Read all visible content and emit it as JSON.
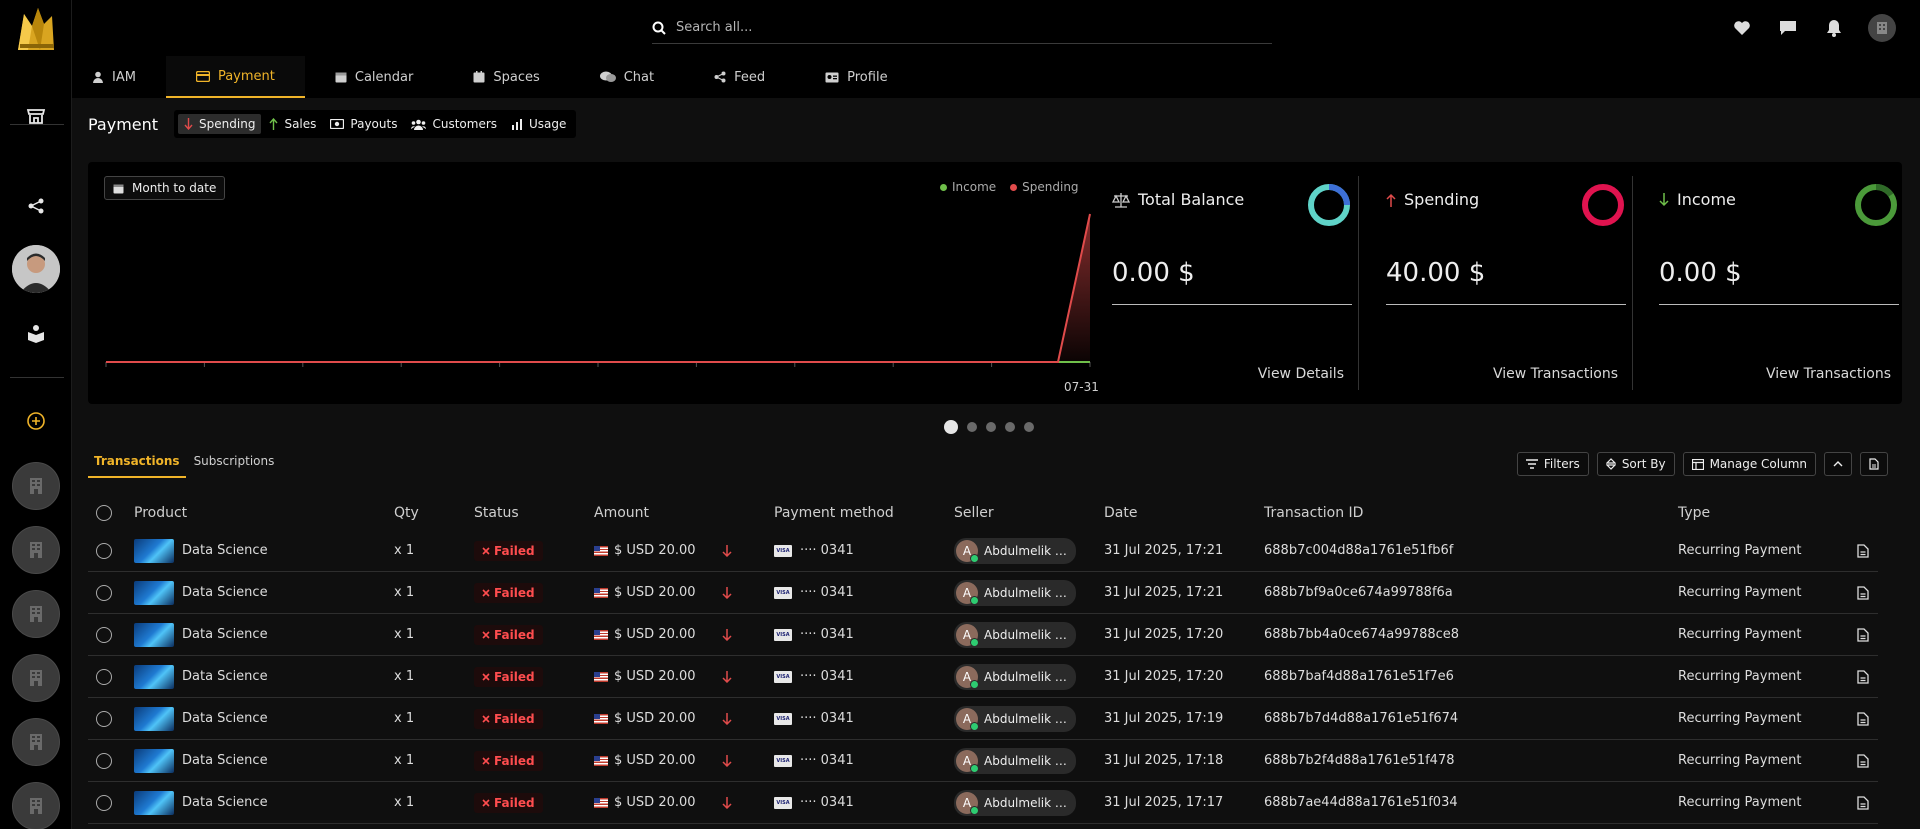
{
  "search": {
    "placeholder": "Search all..."
  },
  "modules": [
    {
      "label": "IAM",
      "icon": "user-icon"
    },
    {
      "label": "Payment",
      "icon": "card-icon",
      "active": true
    },
    {
      "label": "Calendar",
      "icon": "calendar-icon"
    },
    {
      "label": "Spaces",
      "icon": "spaces-icon"
    },
    {
      "label": "Chat",
      "icon": "chat-icon"
    },
    {
      "label": "Feed",
      "icon": "share-icon"
    },
    {
      "label": "Profile",
      "icon": "id-card-icon"
    }
  ],
  "page": {
    "title": "Payment",
    "subtabs": [
      "Spending",
      "Sales",
      "Payouts",
      "Customers",
      "Usage"
    ]
  },
  "overview": {
    "range_label": "Month to date",
    "legend": [
      {
        "name": "Income",
        "color": "#6fbf4a"
      },
      {
        "name": "Spending",
        "color": "#e04b4b"
      }
    ],
    "last_date": "07-31",
    "cards": [
      {
        "title": "Total Balance",
        "value": "0.00 $",
        "link": "View Details",
        "icon": "balance-scale-icon"
      },
      {
        "title": "Spending",
        "value": "40.00 $",
        "link": "View Transactions",
        "icon": "arrow-up-icon"
      },
      {
        "title": "Income",
        "value": "0.00 $",
        "link": "View Transactions",
        "icon": "arrow-down-icon"
      }
    ]
  },
  "chart_data": {
    "type": "line",
    "x": [
      "07-31"
    ],
    "series": [
      {
        "name": "Income",
        "values": [
          0,
          0
        ]
      },
      {
        "name": "Spending",
        "values": [
          0,
          40
        ]
      }
    ]
  },
  "transactions": {
    "tabs": [
      "Transactions",
      "Subscriptions"
    ],
    "actions": {
      "filters": "Filters",
      "sort": "Sort By",
      "manage": "Manage Column"
    },
    "columns": [
      "Product",
      "Qty",
      "Status",
      "Amount",
      "Payment method",
      "Seller",
      "Date",
      "Transaction ID",
      "Type"
    ],
    "rows": [
      {
        "product": "Data Science",
        "qty": "x 1",
        "status": "Failed",
        "amount": "$ USD 20.00",
        "pm": "···· 0341",
        "seller_initial": "A",
        "seller": "Abdulmelik A...",
        "date": "31 Jul 2025, 17:21",
        "tid": "688b7c004d88a1761e51fb6f",
        "type": "Recurring Payment"
      },
      {
        "product": "Data Science",
        "qty": "x 1",
        "status": "Failed",
        "amount": "$ USD 20.00",
        "pm": "···· 0341",
        "seller_initial": "A",
        "seller": "Abdulmelik A...",
        "date": "31 Jul 2025, 17:21",
        "tid": "688b7bf9a0ce674a99788f6a",
        "type": "Recurring Payment"
      },
      {
        "product": "Data Science",
        "qty": "x 1",
        "status": "Failed",
        "amount": "$ USD 20.00",
        "pm": "···· 0341",
        "seller_initial": "A",
        "seller": "Abdulmelik A...",
        "date": "31 Jul 2025, 17:20",
        "tid": "688b7bb4a0ce674a99788ce8",
        "type": "Recurring Payment"
      },
      {
        "product": "Data Science",
        "qty": "x 1",
        "status": "Failed",
        "amount": "$ USD 20.00",
        "pm": "···· 0341",
        "seller_initial": "A",
        "seller": "Abdulmelik A...",
        "date": "31 Jul 2025, 17:20",
        "tid": "688b7baf4d88a1761e51f7e6",
        "type": "Recurring Payment"
      },
      {
        "product": "Data Science",
        "qty": "x 1",
        "status": "Failed",
        "amount": "$ USD 20.00",
        "pm": "···· 0341",
        "seller_initial": "A",
        "seller": "Abdulmelik A...",
        "date": "31 Jul 2025, 17:19",
        "tid": "688b7b7d4d88a1761e51f674",
        "type": "Recurring Payment"
      },
      {
        "product": "Data Science",
        "qty": "x 1",
        "status": "Failed",
        "amount": "$ USD 20.00",
        "pm": "···· 0341",
        "seller_initial": "A",
        "seller": "Abdulmelik A...",
        "date": "31 Jul 2025, 17:18",
        "tid": "688b7b2f4d88a1761e51f478",
        "type": "Recurring Payment"
      },
      {
        "product": "Data Science",
        "qty": "x 1",
        "status": "Failed",
        "amount": "$ USD 20.00",
        "pm": "···· 0341",
        "seller_initial": "A",
        "seller": "Abdulmelik A...",
        "date": "31 Jul 2025, 17:17",
        "tid": "688b7ae44d88a1761e51f034",
        "type": "Recurring Payment"
      }
    ]
  },
  "colors": {
    "accent": "#f0b429",
    "failed": "#ff4d4f",
    "spending": "#e0134f",
    "income": "#4b9a3a",
    "balance": "#5fd3c8"
  }
}
